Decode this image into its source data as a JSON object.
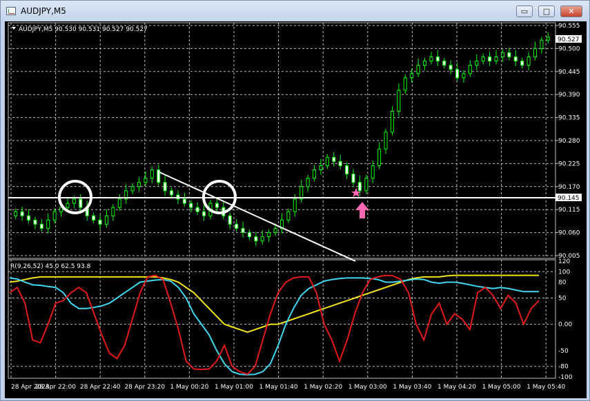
{
  "window": {
    "title": "AUDJPY,M5",
    "minimize_glyph": "▭",
    "maximize_glyph": "□",
    "close_glyph": "✕"
  },
  "main_chart": {
    "header": "AUDJPY,M5  90.530 90.531 90.527 90.527",
    "current_price_label": "90.527",
    "level_line_label": "90.145",
    "price_ticks": [
      "90.555",
      "90.500",
      "90.445",
      "90.390",
      "90.335",
      "90.280",
      "90.225",
      "90.170",
      "90.115",
      "90.060",
      "90.005"
    ]
  },
  "indicator": {
    "header": "R(9,26,52) 45.0 62.5 93.8",
    "ticks": [
      "120",
      "100",
      "80",
      "50",
      "0.00",
      "-50",
      "-80",
      "-100"
    ]
  },
  "time_axis": [
    "28 Apr 2023",
    "28 Apr 22:00",
    "28 Apr 22:40",
    "28 Apr 23:20",
    "1 May 00:20",
    "1 May 01:00",
    "1 May 01:40",
    "1 May 02:20",
    "1 May 03:00",
    "1 May 03:40",
    "1 May 04:20",
    "1 May 05:00",
    "1 May 05:40"
  ],
  "colors": {
    "background": "#000000",
    "grid": "#c0c0c0",
    "candle_up": "#00ff00",
    "candle_down": "#ffffff",
    "level_line": "#ffffff",
    "annotation": "#ff69b4",
    "line_red": "#e31a1a",
    "line_cyan": "#40d8f0",
    "line_yellow": "#f2e51a"
  },
  "chart_data": [
    {
      "type": "candlestick",
      "symbol": "AUDJPY",
      "timeframe": "M5",
      "ylim": [
        90.005,
        90.555
      ],
      "horizontal_level": 90.145,
      "last_price": 90.527,
      "closes_approx": [
        90.11,
        90.1,
        90.09,
        90.08,
        90.07,
        90.09,
        90.11,
        90.12,
        90.13,
        90.14,
        90.12,
        90.1,
        90.09,
        90.08,
        90.1,
        90.12,
        90.14,
        90.16,
        90.17,
        90.18,
        90.19,
        90.21,
        90.18,
        90.16,
        90.15,
        90.14,
        90.13,
        90.12,
        90.11,
        90.1,
        90.13,
        90.12,
        90.1,
        90.08,
        90.07,
        90.06,
        90.05,
        90.04,
        90.05,
        90.06,
        90.07,
        90.09,
        90.11,
        90.14,
        90.17,
        90.19,
        90.21,
        90.22,
        90.24,
        90.23,
        90.22,
        90.2,
        90.18,
        90.16,
        90.19,
        90.22,
        90.26,
        90.3,
        90.35,
        90.4,
        90.43,
        90.44,
        90.46,
        90.47,
        90.48,
        90.47,
        90.46,
        90.45,
        90.43,
        90.44,
        90.46,
        90.47,
        90.48,
        90.47,
        90.48,
        90.49,
        90.48,
        90.47,
        90.46,
        90.48,
        90.5,
        90.52,
        90.527
      ]
    },
    {
      "type": "line",
      "name": "R(9,26,52)",
      "ylim": [
        -100,
        120
      ],
      "last_values": [
        45.0,
        62.5,
        93.8
      ]
    }
  ]
}
